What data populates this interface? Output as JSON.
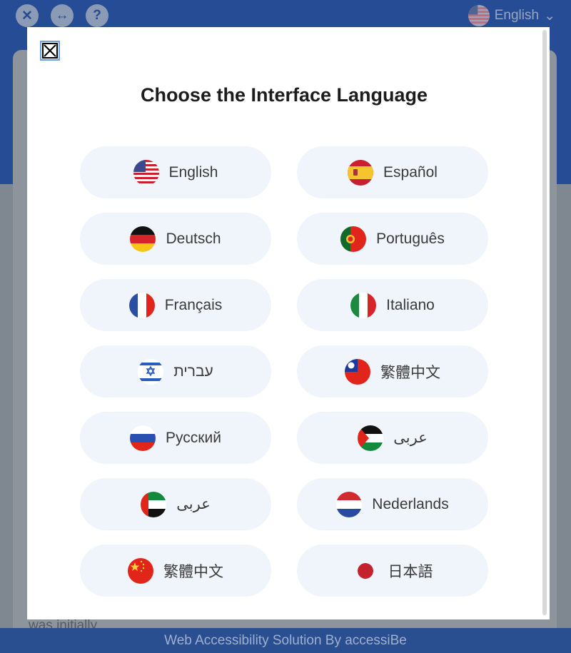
{
  "widget": {
    "top_language": "English",
    "footer": "Web Accessibility Solution By accessiBe",
    "background_text": "was initially"
  },
  "modal": {
    "title": "Choose the Interface Language",
    "languages": [
      {
        "label": "English",
        "flag": "us-flag-icon"
      },
      {
        "label": "Español",
        "flag": "spain-flag-icon"
      },
      {
        "label": "Deutsch",
        "flag": "germany-flag-icon"
      },
      {
        "label": "Português",
        "flag": "portugal-flag-icon"
      },
      {
        "label": "Français",
        "flag": "france-flag-icon"
      },
      {
        "label": "Italiano",
        "flag": "italy-flag-icon"
      },
      {
        "label": "עברית",
        "flag": "israel-flag-icon"
      },
      {
        "label": "繁體中文",
        "flag": "taiwan-flag-icon"
      },
      {
        "label": "Русский",
        "flag": "russia-flag-icon"
      },
      {
        "label": "عربى",
        "flag": "palestine-flag-icon"
      },
      {
        "label": "عربى",
        "flag": "uae-flag-icon"
      },
      {
        "label": "Nederlands",
        "flag": "netherlands-flag-icon"
      },
      {
        "label": "繁體中文",
        "flag": "china-flag-icon"
      },
      {
        "label": "日本語",
        "flag": "japan-flag-icon"
      }
    ]
  },
  "colors": {
    "header_blue": "#264c95",
    "button_bg": "#f0f5fb",
    "focus_outline": "#6ea0e6"
  }
}
